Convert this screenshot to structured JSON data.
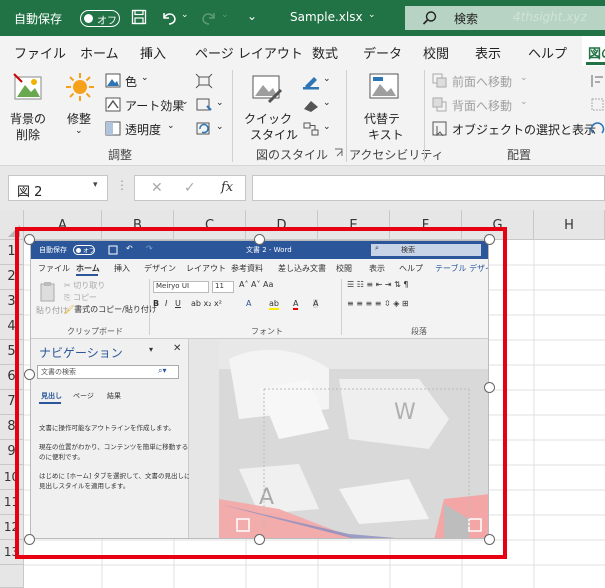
{
  "titlebar": {
    "autosave_label": "自動保存",
    "autosave_state": "オフ",
    "filename": "Sample.xlsx",
    "search_label": "検索",
    "watermark": "4thsight.xyz"
  },
  "tabs": [
    "ファイル",
    "ホーム",
    "挿入",
    "ページ レイアウト",
    "数式",
    "データ",
    "校閲",
    "表示",
    "ヘルプ",
    "図の"
  ],
  "ribbon": {
    "remove_bg": [
      "背景の",
      "削除"
    ],
    "corrections": "修整",
    "color": "色",
    "artistic": "アート効果",
    "transparency": "透明度",
    "group_adjust": "調整",
    "quick_styles": [
      "クイック",
      "スタイル"
    ],
    "group_styles": "図のスタイル",
    "alt_text": [
      "代替テ",
      "キスト"
    ],
    "group_access": "アクセシビリティ",
    "bring_forward": "前面へ移動",
    "send_backward": "背面へ移動",
    "selection_pane": "オブジェクトの選択と表示",
    "group_arrange": "配置"
  },
  "formula_bar": {
    "name_box": "図 2",
    "fx": "fx"
  },
  "columns": [
    "A",
    "B",
    "C",
    "D",
    "E",
    "F",
    "G",
    "H"
  ],
  "rows": [
    "1",
    "2",
    "3",
    "4",
    "5",
    "6",
    "7",
    "8",
    "9",
    "10",
    "11",
    "12",
    "13"
  ],
  "word": {
    "autosave": "自動保存",
    "autosave_state": "オフ",
    "title": "文書 2 - Word",
    "search": "検索",
    "tabs": [
      "ファイル",
      "ホーム",
      "挿入",
      "デザイン",
      "レイアウト",
      "参考資料",
      "差し込み文書",
      "校閲",
      "表示",
      "ヘルプ",
      "テーブル デザイン"
    ],
    "cut": "切り取り",
    "copy": "コピー",
    "paste": "貼り付け",
    "format_painter": "書式のコピー/貼り付け",
    "clipboard_group": "クリップボード",
    "font_name": "Meiryo UI",
    "font_size": "11",
    "font_group": "フォント",
    "paragraph_group": "段落",
    "nav_title": "ナビゲーション",
    "nav_search_placeholder": "文書の検索",
    "nav_tabs": [
      "見出し",
      "ページ",
      "結果"
    ],
    "nav_text1": "文書に操作可能なアウトラインを作成します。",
    "nav_text2": [
      "現在の位置がわかり、コンテンツを簡単に移動する",
      "のに便利です。"
    ],
    "nav_text3": [
      "はじめに [ホーム] タブを選択して、文書の見出しに",
      "見出しスタイルを適用します。"
    ]
  },
  "colors": {
    "excel_green": "#217346",
    "word_blue": "#2b579a",
    "selection_red": "#e60012"
  }
}
